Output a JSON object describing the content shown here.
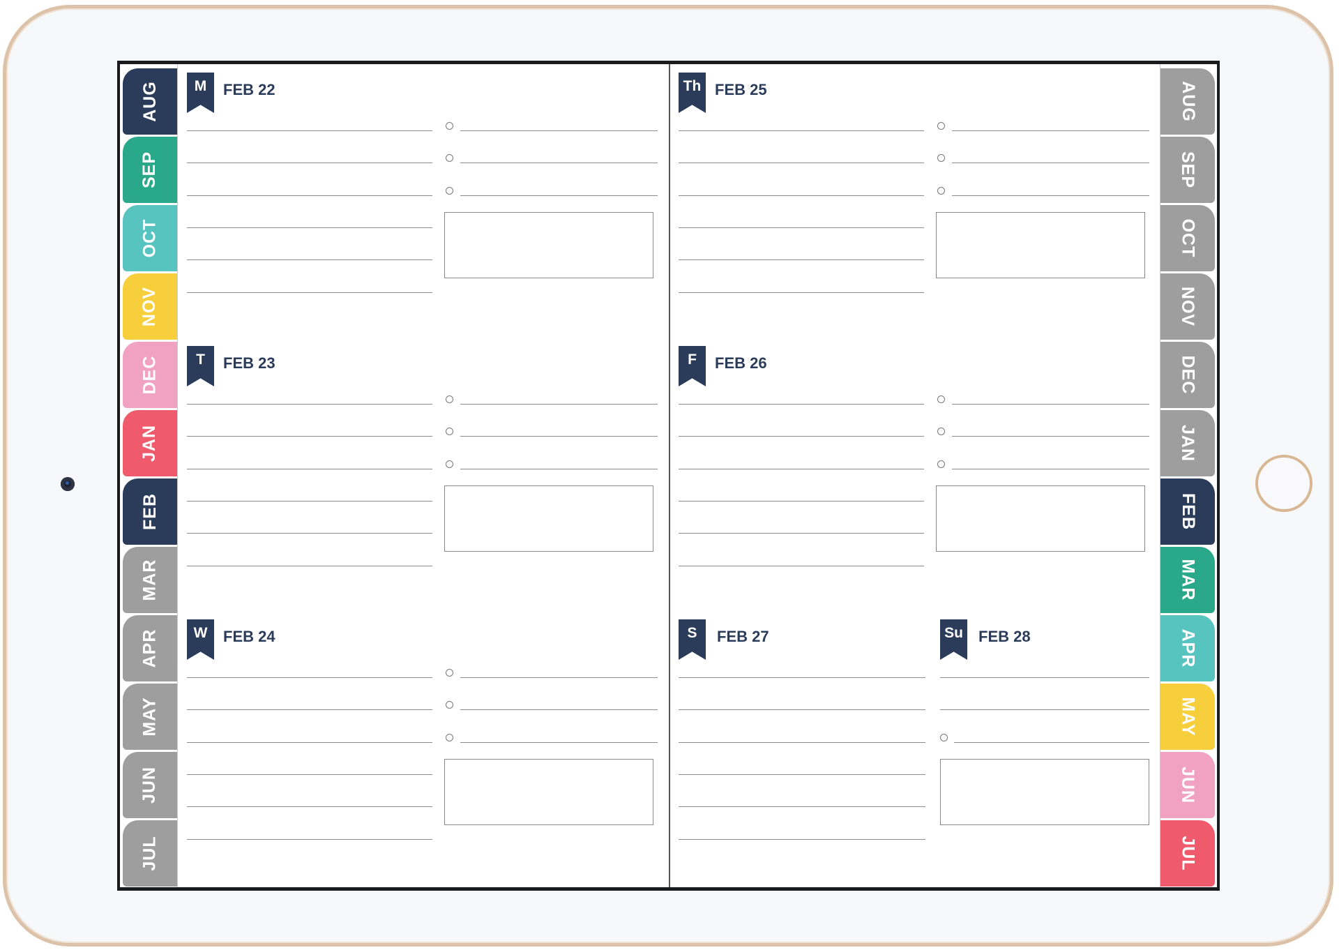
{
  "left_tabs": [
    {
      "label": "AUG",
      "color": "#2b3b5a"
    },
    {
      "label": "SEP",
      "color": "#2aa98a"
    },
    {
      "label": "OCT",
      "color": "#57c4c0"
    },
    {
      "label": "NOV",
      "color": "#f7cf3c"
    },
    {
      "label": "DEC",
      "color": "#f1a1c2"
    },
    {
      "label": "JAN",
      "color": "#ef5a6c"
    },
    {
      "label": "FEB",
      "color": "#2b3b5a"
    },
    {
      "label": "MAR",
      "color": "#9e9e9e"
    },
    {
      "label": "APR",
      "color": "#9e9e9e"
    },
    {
      "label": "MAY",
      "color": "#9e9e9e"
    },
    {
      "label": "JUN",
      "color": "#9e9e9e"
    },
    {
      "label": "JUL",
      "color": "#9e9e9e"
    }
  ],
  "right_tabs": [
    {
      "label": "AUG",
      "color": "#9e9e9e"
    },
    {
      "label": "SEP",
      "color": "#9e9e9e"
    },
    {
      "label": "OCT",
      "color": "#9e9e9e"
    },
    {
      "label": "NOV",
      "color": "#9e9e9e"
    },
    {
      "label": "DEC",
      "color": "#9e9e9e"
    },
    {
      "label": "JAN",
      "color": "#9e9e9e"
    },
    {
      "label": "FEB",
      "color": "#2b3b5a"
    },
    {
      "label": "MAR",
      "color": "#2aa98a"
    },
    {
      "label": "APR",
      "color": "#57c4c0"
    },
    {
      "label": "MAY",
      "color": "#f7cf3c"
    },
    {
      "label": "JUN",
      "color": "#f1a1c2"
    },
    {
      "label": "JUL",
      "color": "#ef5a6c"
    }
  ],
  "days": {
    "mon": {
      "abbr": "M",
      "date": "FEB 22"
    },
    "tue": {
      "abbr": "T",
      "date": "FEB 23"
    },
    "wed": {
      "abbr": "W",
      "date": "FEB 24"
    },
    "thu": {
      "abbr": "Th",
      "date": "FEB 25"
    },
    "fri": {
      "abbr": "F",
      "date": "FEB 26"
    },
    "sat": {
      "abbr": "S",
      "date": "FEB 27"
    },
    "sun": {
      "abbr": "Su",
      "date": "FEB 28"
    }
  }
}
